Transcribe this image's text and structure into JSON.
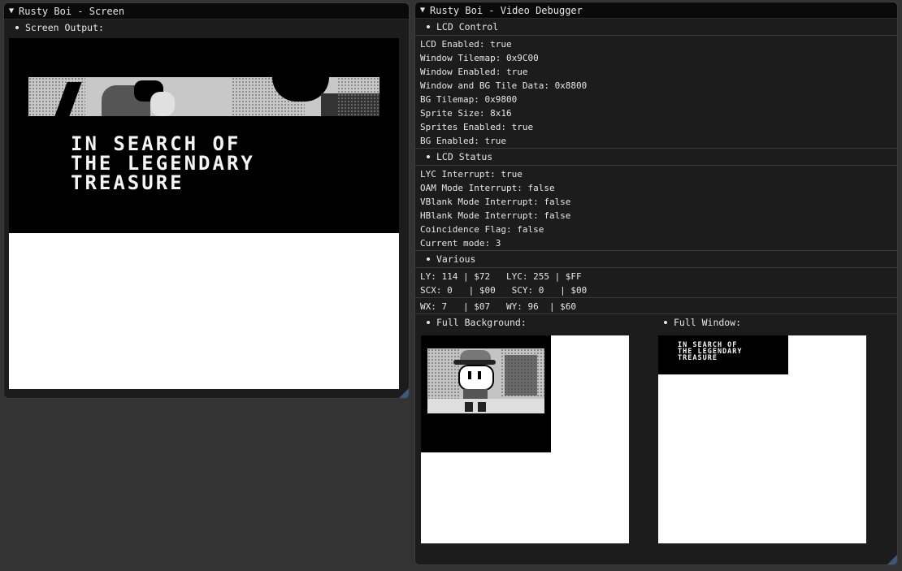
{
  "screen_window": {
    "title": "Rusty Boi - Screen",
    "header": "Screen Output:",
    "game_text": [
      "IN SEARCH OF",
      "THE LEGENDARY",
      "TREASURE"
    ]
  },
  "debug_window": {
    "title": "Rusty Boi - Video Debugger",
    "lcd_control": {
      "header": "LCD Control",
      "lines": [
        "LCD Enabled: true",
        "Window Tilemap: 0x9C00",
        "Window Enabled: true",
        "Window and BG Tile Data: 0x8800",
        "BG Tilemap: 0x9800",
        "Sprite Size: 8x16",
        "Sprites Enabled: true",
        "BG Enabled: true"
      ]
    },
    "lcd_status": {
      "header": "LCD Status",
      "lines": [
        "LYC Interrupt: true",
        "OAM Mode Interrupt: false",
        "VBlank Mode Interrupt: false",
        "HBlank Mode Interrupt: false",
        "Coincidence Flag: false",
        "Current mode: 3"
      ]
    },
    "various": {
      "header": "Various",
      "lines": [
        "LY: 114 | $72   LYC: 255 | $FF",
        "SCX: 0   | $00   SCY: 0   | $00"
      ],
      "wx_line": "WX: 7   | $07   WY: 96  | $60"
    },
    "full_background": {
      "header": "Full Background:"
    },
    "full_window": {
      "header": "Full Window:",
      "text": [
        "IN SEARCH OF",
        "THE LEGENDARY",
        "TREASURE"
      ]
    }
  }
}
